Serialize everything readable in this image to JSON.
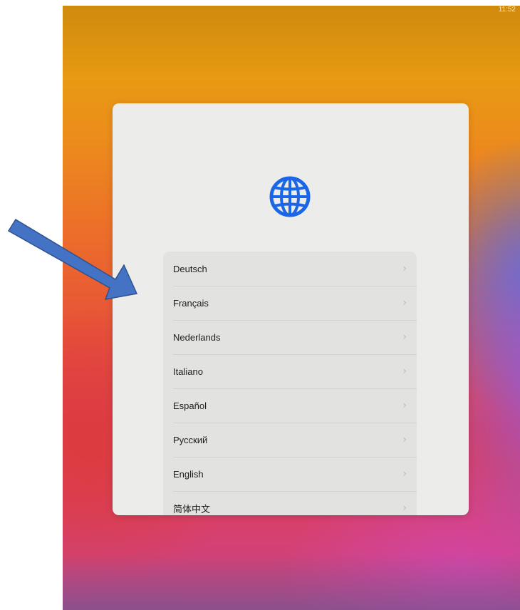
{
  "setup": {
    "status_indicator": "11:52",
    "languages": [
      {
        "label": "Deutsch"
      },
      {
        "label": "Français"
      },
      {
        "label": "Nederlands"
      },
      {
        "label": "Italiano"
      },
      {
        "label": "Español"
      },
      {
        "label": "Русский"
      },
      {
        "label": "English"
      },
      {
        "label": "简体中文"
      }
    ],
    "chevron": "›"
  },
  "colors": {
    "globe_accent": "#1a66e6",
    "annotation_arrow": "#4472c4"
  },
  "icons": [
    "globe-icon",
    "chevron-right-icon",
    "annotation-arrow"
  ]
}
